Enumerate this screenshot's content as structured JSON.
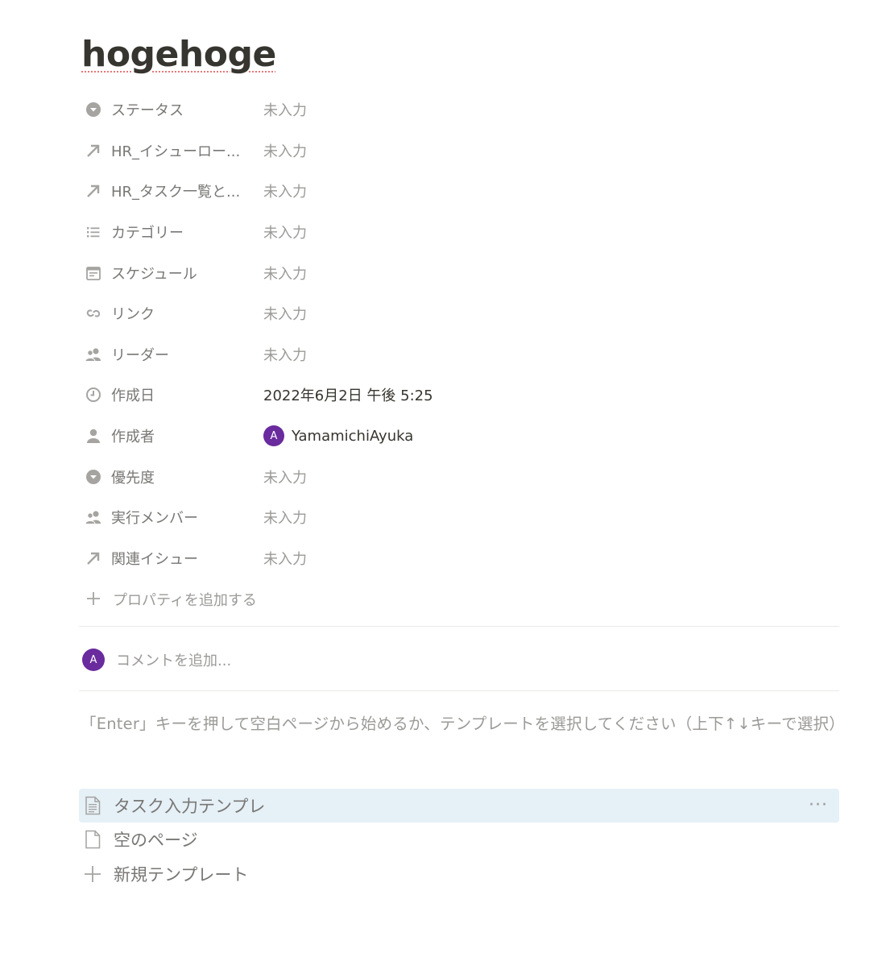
{
  "page": {
    "title": "hogehoge"
  },
  "properties": [
    {
      "icon": "select-icon",
      "name": "ステータス",
      "value": "未入力"
    },
    {
      "icon": "relation-arrow-icon",
      "name": "HR_イシューロー...",
      "value": "未入力"
    },
    {
      "icon": "relation-arrow-icon",
      "name": "HR_タスク一覧と...",
      "value": "未入力"
    },
    {
      "icon": "list-icon",
      "name": "カテゴリー",
      "value": "未入力"
    },
    {
      "icon": "calendar-icon",
      "name": "スケジュール",
      "value": "未入力"
    },
    {
      "icon": "link-icon",
      "name": "リンク",
      "value": "未入力"
    },
    {
      "icon": "people-icon",
      "name": "リーダー",
      "value": "未入力"
    },
    {
      "icon": "clock-icon",
      "name": "作成日",
      "value": "2022年6月2日 午後 5:25"
    },
    {
      "icon": "person-icon",
      "name": "作成者",
      "value": "YamamichiAyuka",
      "avatar_initial": "A"
    },
    {
      "icon": "select-icon",
      "name": "優先度",
      "value": "未入力"
    },
    {
      "icon": "people-icon",
      "name": "実行メンバー",
      "value": "未入力"
    },
    {
      "icon": "relation-arrow-icon",
      "name": "関連イシュー",
      "value": "未入力"
    }
  ],
  "add_property": {
    "label": "プロパティを追加する"
  },
  "comment": {
    "avatar_initial": "A",
    "placeholder": "コメントを追加..."
  },
  "template_hint": "「Enter」キーを押して空白ページから始めるか、テンプレートを選択してください（上下↑↓キーで選択）",
  "templates": [
    {
      "icon": "document-template-icon",
      "label": "タスク入力テンプレ",
      "selected": true,
      "more": "···"
    },
    {
      "icon": "empty-page-icon",
      "label": "空のページ",
      "selected": false
    },
    {
      "icon": "plus-icon",
      "label": "新規テンプレート",
      "selected": false
    }
  ],
  "colors": {
    "avatar": "#6a2b9e",
    "selected_template_bg": "#e6f0f7",
    "placeholder_text": "#9b9a97",
    "property_label": "#787774",
    "title_text": "#37352f"
  }
}
